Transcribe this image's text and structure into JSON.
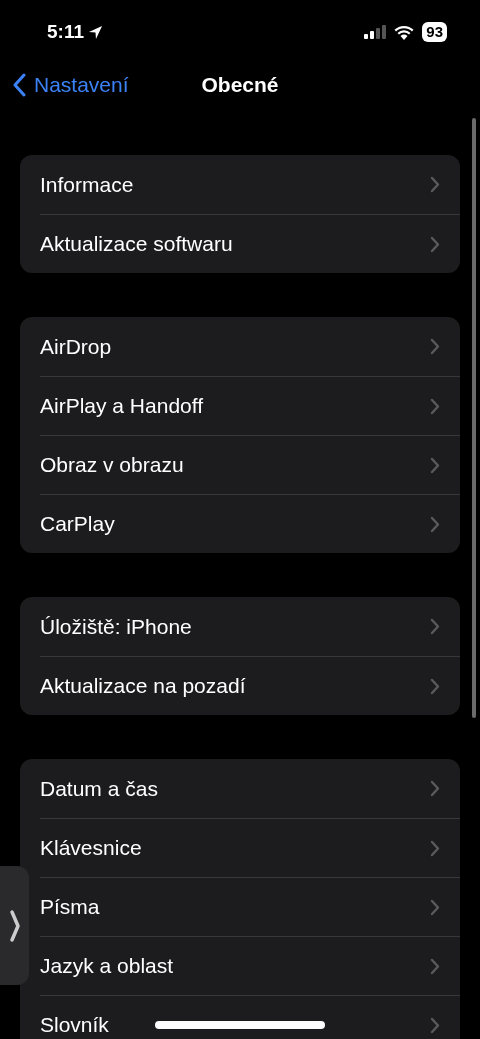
{
  "status_bar": {
    "time": "5:11",
    "battery": "93"
  },
  "nav": {
    "back": "Nastavení",
    "title": "Obecné"
  },
  "groups": [
    {
      "items": [
        "Informace",
        "Aktualizace softwaru"
      ]
    },
    {
      "items": [
        "AirDrop",
        "AirPlay a Handoff",
        "Obraz v obrazu",
        "CarPlay"
      ]
    },
    {
      "items": [
        "Úložiště: iPhone",
        "Aktualizace na pozadí"
      ]
    },
    {
      "items": [
        "Datum a čas",
        "Klávesnice",
        "Písma",
        "Jazyk a oblast",
        "Slovník"
      ]
    }
  ]
}
